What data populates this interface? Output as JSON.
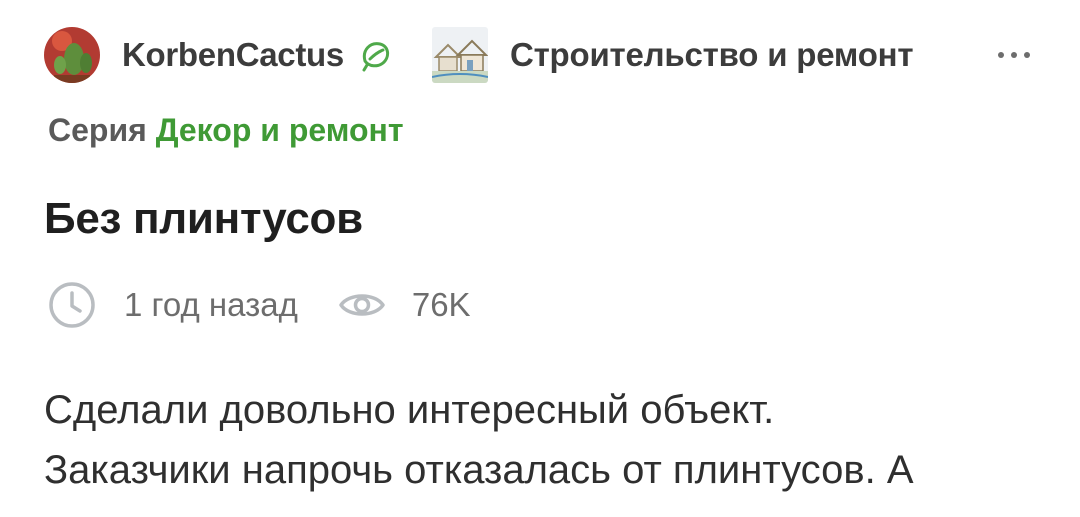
{
  "header": {
    "author": "KorbenCactus",
    "author_avatar_icon": "cactus-avatar",
    "badge_icon": "leaf-badge-icon",
    "community": "Строительство и ремонт",
    "community_thumb_icon": "houses-thumbnail",
    "more_icon": "more-dots-icon"
  },
  "series": {
    "label": "Серия",
    "name": "Декор и ремонт"
  },
  "post": {
    "title": "Без плинтусов",
    "time": "1 год назад",
    "views": "76K",
    "text_lines": [
      "Сделали довольно интересный объект.",
      "Заказчики напрочь отказалась от плинтусов. А"
    ]
  },
  "colors": {
    "accent_green": "#3f9a35",
    "text_dark": "#2b2b2b",
    "text_muted": "#6d6d6d"
  }
}
